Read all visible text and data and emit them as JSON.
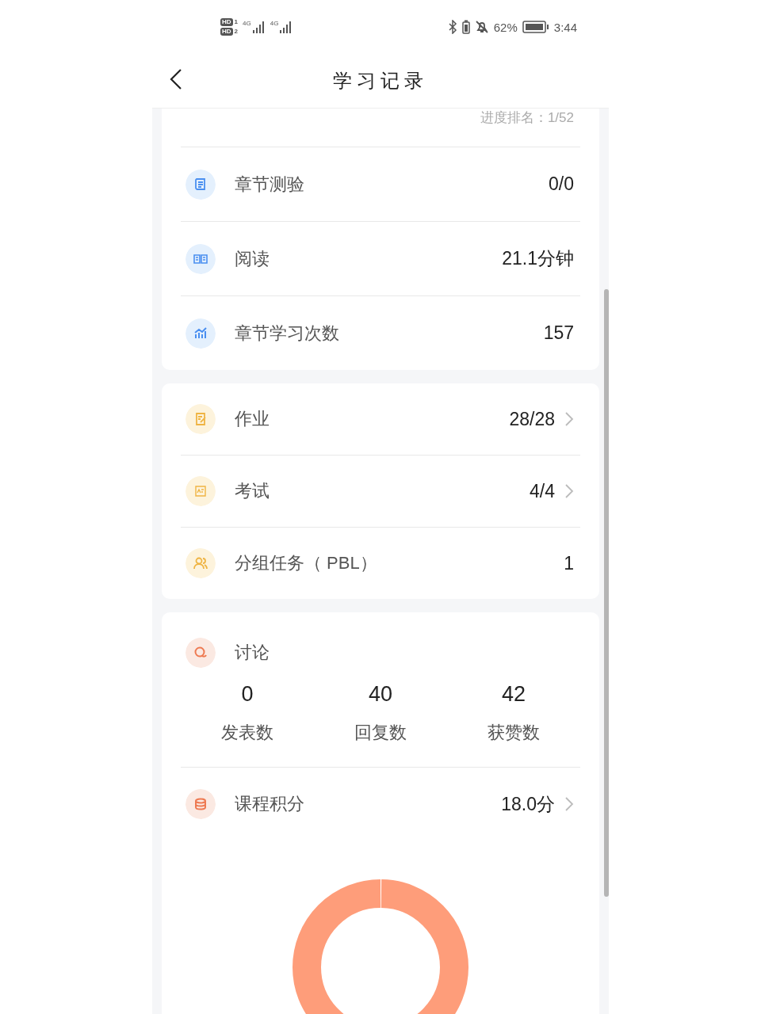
{
  "status_bar": {
    "networks": [
      {
        "badge": "HD",
        "sim": "1",
        "tech": "4G"
      },
      {
        "badge": "HD",
        "sim": "2",
        "tech": "4G"
      }
    ],
    "battery": "62%",
    "time": "3:44"
  },
  "header": {
    "title": "学习记录"
  },
  "progress_rank": "进度排名：1/52",
  "sections": [
    {
      "rows": [
        {
          "kind": "quiz",
          "label": "章节测验",
          "value": "0/0",
          "has_arrow": false
        },
        {
          "kind": "book",
          "label": "阅读",
          "value": "21.1分钟",
          "has_arrow": false
        },
        {
          "kind": "chart",
          "label": "章节学习次数",
          "value": "157",
          "has_arrow": false
        }
      ]
    },
    {
      "rows": [
        {
          "kind": "homework",
          "label": "作业",
          "value": "28/28",
          "has_arrow": true
        },
        {
          "kind": "exam",
          "label": "考试",
          "value": "4/4",
          "has_arrow": true
        },
        {
          "kind": "group",
          "label": "分组任务（ PBL）",
          "value": "1",
          "has_arrow": false
        }
      ]
    }
  ],
  "discussion": {
    "title": "讨论",
    "stats": [
      {
        "value": "0",
        "label": "发表数"
      },
      {
        "value": "40",
        "label": "回复数"
      },
      {
        "value": "42",
        "label": "获赞数"
      }
    ]
  },
  "points": {
    "label": "课程积分",
    "value": "18.0分",
    "has_arrow": true
  }
}
